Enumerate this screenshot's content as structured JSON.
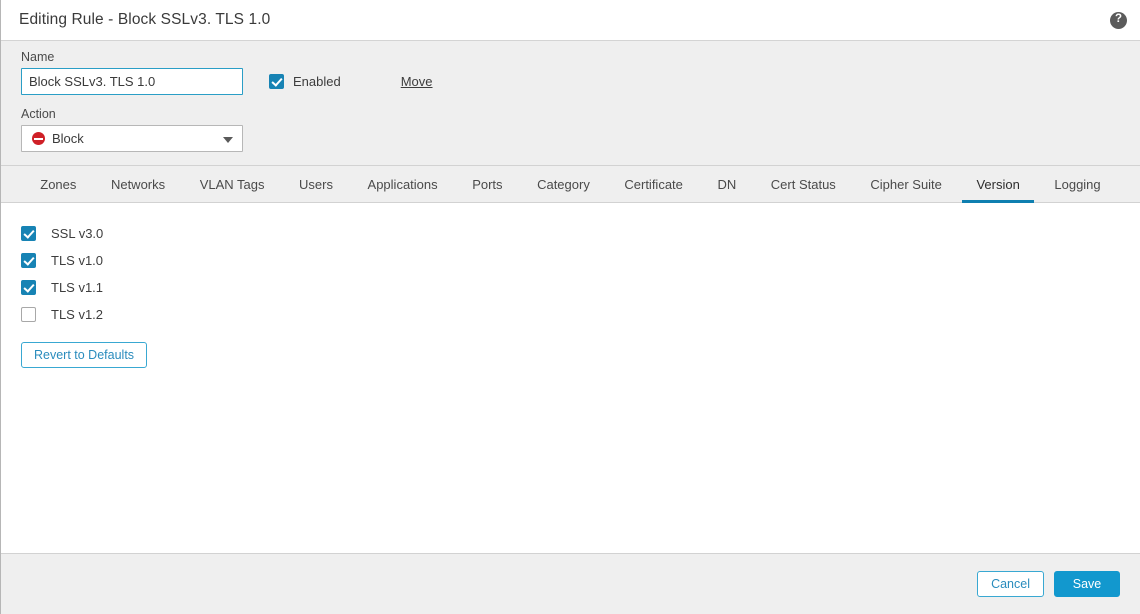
{
  "header": {
    "title": "Editing Rule - Block SSLv3. TLS 1.0",
    "help_icon": "question-mark-icon",
    "help_glyph": "?"
  },
  "form": {
    "name_label": "Name",
    "name_value": "Block SSLv3. TLS 1.0",
    "name_placeholder": "",
    "enabled_label": "Enabled",
    "enabled_checked": true,
    "move_label": "Move",
    "action_label": "Action",
    "action_value": "Block",
    "action_icon": "block-deny-icon",
    "action_icon_color": "#cf2027"
  },
  "tabs": {
    "active": "Version",
    "items": [
      {
        "label": "Zones"
      },
      {
        "label": "Networks"
      },
      {
        "label": "VLAN Tags"
      },
      {
        "label": "Users"
      },
      {
        "label": "Applications"
      },
      {
        "label": "Ports"
      },
      {
        "label": "Category"
      },
      {
        "label": "Certificate"
      },
      {
        "label": "DN"
      },
      {
        "label": "Cert Status"
      },
      {
        "label": "Cipher Suite"
      },
      {
        "label": "Version"
      },
      {
        "label": "Logging"
      }
    ]
  },
  "version_panel": {
    "options": [
      {
        "label": "SSL v3.0",
        "checked": true
      },
      {
        "label": "TLS v1.0",
        "checked": true
      },
      {
        "label": "TLS v1.1",
        "checked": true
      },
      {
        "label": "TLS v1.2",
        "checked": false
      }
    ],
    "revert_label": "Revert to Defaults"
  },
  "footer": {
    "cancel_label": "Cancel",
    "save_label": "Save"
  },
  "colors": {
    "accent": "#1298ce",
    "tab_underline": "#0f7fb0",
    "checkbox_on": "#1783b4",
    "block_red": "#cf2027",
    "panel_gray": "#efefef"
  }
}
